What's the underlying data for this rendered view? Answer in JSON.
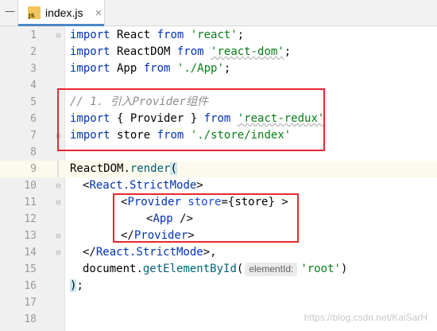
{
  "tab": {
    "filename": "index.js",
    "icon_text": "JS",
    "close_glyph": "×"
  },
  "line_numbers": [
    "1",
    "2",
    "3",
    "4",
    "5",
    "6",
    "7",
    "8",
    "9",
    "10",
    "11",
    "12",
    "13",
    "14",
    "15",
    "16",
    "17",
    "18"
  ],
  "code": {
    "l1": {
      "kw": "import",
      "name": " React ",
      "from": "from",
      "str": "'react'",
      "end": ";"
    },
    "l2": {
      "kw": "import",
      "name": " ReactDOM ",
      "from": "from",
      "str": "'react-dom'",
      "end": ";"
    },
    "l3": {
      "kw": "import",
      "name": " App ",
      "from": "from",
      "str": "'./App'",
      "end": ";"
    },
    "l5": {
      "comment": "// 1. 引入Provider组件"
    },
    "l6": {
      "kw": "import",
      "name": " { Provider } ",
      "from": "from",
      "str": "'react-redux'"
    },
    "l7": {
      "kw": "import",
      "name": " store ",
      "from": "from",
      "str": "'./store/index'"
    },
    "l9": {
      "obj": "ReactDOM",
      "dot": ".",
      "method": "render",
      "paren": "("
    },
    "l10": {
      "open": "<",
      "tag": "React.StrictMode",
      "close": ">"
    },
    "l11": {
      "open": "<",
      "tag": "Provider",
      "attr": " store",
      "eq": "=",
      "brace_open": "{",
      "value": "store",
      "brace_close": "}",
      "close": " >"
    },
    "l12": {
      "open": "<",
      "tag": "App",
      "close": " />"
    },
    "l13": {
      "open": "</",
      "tag": "Provider",
      "close": ">"
    },
    "l14": {
      "open": "</",
      "tag": "React.StrictMode",
      "close": ">,"
    },
    "l15": {
      "obj": "document",
      "dot": ".",
      "method": "getElementById",
      "paren": "(",
      "hint": "elementId:",
      "str": "'root'",
      "paren_close": ")"
    },
    "l16": {
      "paren": ")",
      "end": ";"
    }
  },
  "watermark": "https://blog.csdn.net/KaiSarH",
  "colors": {
    "keyword": "#0033b3",
    "string": "#067d17",
    "comment": "#8c8c8c",
    "highlight_box": "#e8282f"
  }
}
